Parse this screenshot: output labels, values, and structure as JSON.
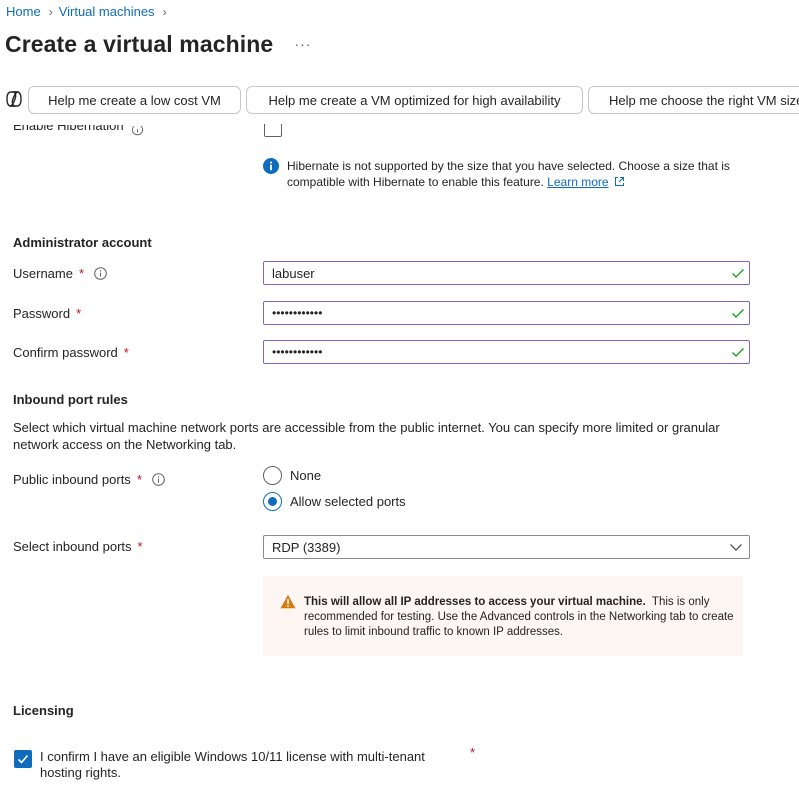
{
  "breadcrumb": {
    "items": [
      "Home",
      "Virtual machines"
    ]
  },
  "page": {
    "title": "Create a virtual machine",
    "more": "···"
  },
  "copilot": {
    "suggestions": [
      "Help me create a low cost VM",
      "Help me create a VM optimized for high availability",
      "Help me choose the right VM size"
    ]
  },
  "hibernation": {
    "label": "Enable Hibernation",
    "info_text": "Hibernate is not supported by the size that you have selected. Choose a size that is compatible with Hibernate to enable this feature.",
    "link": "Learn more"
  },
  "admin": {
    "heading": "Administrator account",
    "username_label": "Username",
    "username_value": "labuser",
    "password_label": "Password",
    "password_value": "••••••••••••",
    "confirm_label": "Confirm password",
    "confirm_value": "••••••••••••",
    "required": "*"
  },
  "inbound": {
    "heading": "Inbound port rules",
    "description": "Select which virtual machine network ports are accessible from the public internet. You can specify more limited or granular network access on the Networking tab.",
    "public_label": "Public inbound ports",
    "options": [
      "None",
      "Allow selected ports"
    ],
    "selected_option": "Allow selected ports",
    "select_label": "Select inbound ports",
    "select_value": "RDP (3389)",
    "warning_bold": "This will allow all IP addresses to access your virtual machine.",
    "warning_rest": "This is only recommended for testing.  Use the Advanced controls in the Networking tab to create rules to limit inbound traffic to known IP addresses."
  },
  "licensing": {
    "heading": "Licensing",
    "confirm_text": "I confirm I have an eligible Windows 10/11 license with multi-tenant hosting rights.",
    "checked": true
  },
  "colors": {
    "accent": "#0f6cbd",
    "required": "#c50f1f",
    "valid": "#13a10e",
    "input_border": "#8764b8",
    "warning_bg": "#fdf6f3",
    "warning_icon": "#da7b11"
  }
}
